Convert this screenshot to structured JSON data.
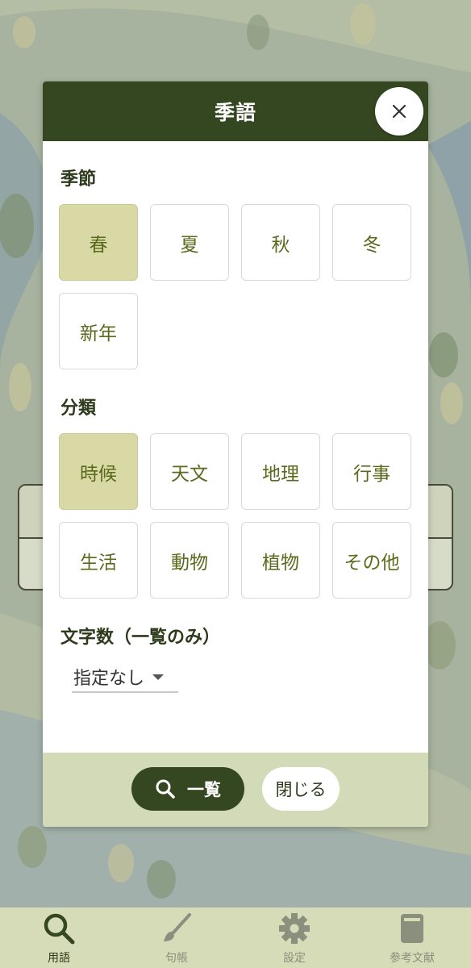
{
  "modal": {
    "title": "季語",
    "close_icon": "close-icon"
  },
  "season": {
    "title": "季節",
    "options": [
      {
        "label": "春",
        "selected": true
      },
      {
        "label": "夏",
        "selected": false
      },
      {
        "label": "秋",
        "selected": false
      },
      {
        "label": "冬",
        "selected": false
      },
      {
        "label": "新年",
        "selected": false
      }
    ]
  },
  "category": {
    "title": "分類",
    "options": [
      {
        "label": "時候",
        "selected": true
      },
      {
        "label": "天文",
        "selected": false
      },
      {
        "label": "地理",
        "selected": false
      },
      {
        "label": "行事",
        "selected": false
      },
      {
        "label": "生活",
        "selected": false
      },
      {
        "label": "動物",
        "selected": false
      },
      {
        "label": "植物",
        "selected": false
      },
      {
        "label": "その他",
        "selected": false
      }
    ]
  },
  "char_count": {
    "title": "文字数（一覧のみ）",
    "selected": "指定なし"
  },
  "footer": {
    "list_label": "一覧",
    "close_label": "閉じる"
  },
  "nav": {
    "items": [
      {
        "label": "用語",
        "icon": "search-icon",
        "active": true
      },
      {
        "label": "句帳",
        "icon": "brush-icon",
        "active": false
      },
      {
        "label": "設定",
        "icon": "gear-icon",
        "active": false
      },
      {
        "label": "参考文献",
        "icon": "book-icon",
        "active": false
      }
    ]
  },
  "colors": {
    "header": "#354720",
    "selected_chip": "#d9d9a6",
    "chip_text": "#5a6a1c",
    "footer_bg": "#d3dab7"
  }
}
